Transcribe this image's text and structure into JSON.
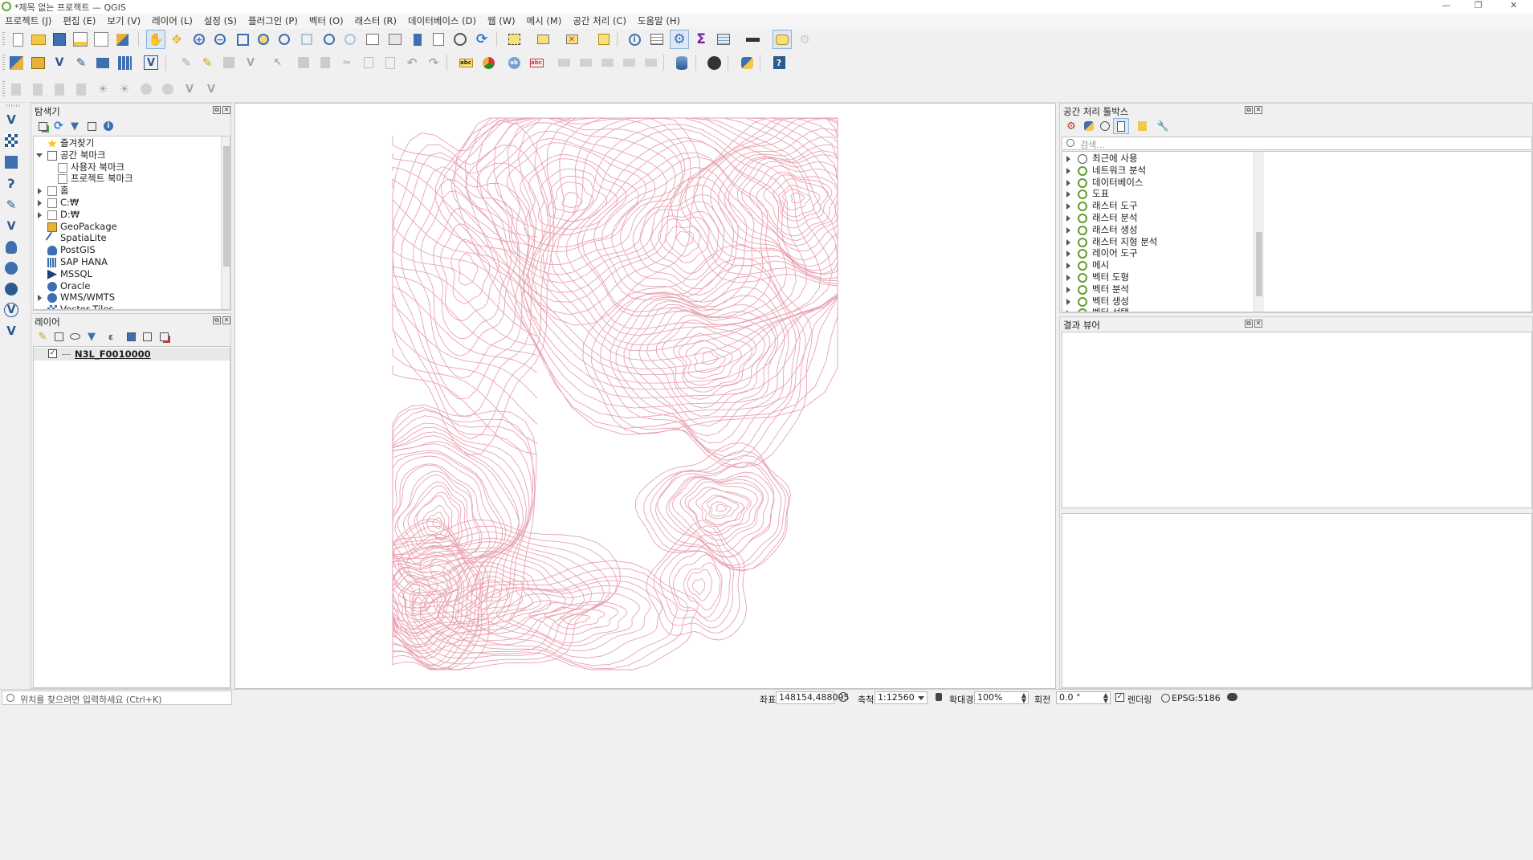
{
  "window": {
    "title": "*제목 없는 프로젝트 — QGIS",
    "controls": [
      "—",
      "❐",
      "✕"
    ]
  },
  "menu": [
    "프로젝트 (J)",
    "편집 (E)",
    "보기 (V)",
    "레이어 (L)",
    "설정 (S)",
    "플러그인 (P)",
    "벡터 (O)",
    "래스터 (R)",
    "데이터베이스 (D)",
    "웹 (W)",
    "메시 (M)",
    "공간 처리 (C)",
    "도움말 (H)"
  ],
  "browser": {
    "title": "탐색기",
    "items": [
      {
        "label": "즐겨찾기",
        "icon": "star-icon",
        "expand": "none"
      },
      {
        "label": "공간 북마크",
        "icon": "bookmark-icon",
        "expand": "down"
      },
      {
        "label": "사용자 북마크",
        "icon": "folder-icon",
        "expand": "none"
      },
      {
        "label": "프로젝트 북마크",
        "icon": "folder-icon",
        "expand": "none"
      },
      {
        "label": "홈",
        "icon": "home-folder-icon",
        "expand": "right"
      },
      {
        "label": "C:₩",
        "icon": "drive-icon",
        "expand": "right"
      },
      {
        "label": "D:₩",
        "icon": "drive-icon",
        "expand": "right"
      },
      {
        "label": "GeoPackage",
        "icon": "geopackage-icon",
        "expand": "none"
      },
      {
        "label": "SpatiaLite",
        "icon": "spatialite-icon",
        "expand": "none"
      },
      {
        "label": "PostGIS",
        "icon": "postgis-icon",
        "expand": "none"
      },
      {
        "label": "SAP HANA",
        "icon": "sap-hana-icon",
        "expand": "none"
      },
      {
        "label": "MSSQL",
        "icon": "mssql-icon",
        "expand": "none"
      },
      {
        "label": "Oracle",
        "icon": "oracle-icon",
        "expand": "none"
      },
      {
        "label": "WMS/WMTS",
        "icon": "wms-icon",
        "expand": "right"
      },
      {
        "label": "Vector Tiles",
        "icon": "vector-tiles-icon",
        "expand": "none"
      }
    ]
  },
  "layers": {
    "title": "레이어",
    "items": [
      {
        "label": "N3L_F0010000",
        "checked": true,
        "symbol_color": "#9a9a9a"
      }
    ]
  },
  "toolbox": {
    "title": "공간 처리 툴박스",
    "search_placeholder": "검색...",
    "items": [
      "최근에 사용",
      "네트워크 분석",
      "데이터베이스",
      "도표",
      "래스터 도구",
      "래스터 분석",
      "래스터 생성",
      "래스터 지형 분석",
      "레이어 도구",
      "메시",
      "벡터 도형",
      "벡터 분석",
      "벡터 생성",
      "벡터 선택"
    ]
  },
  "results": {
    "title": "결과 뷰어"
  },
  "map": {
    "line_color": "#e8a2b2",
    "background": "#ffffff"
  },
  "status": {
    "locator_placeholder": "위치를 찾으려면 입력하세요 (Ctrl+K)",
    "coord_label": "좌표",
    "coord_value": "148154,488095",
    "scale_label": "축척",
    "scale_value": "1:12560",
    "magnifier_label": "확대경",
    "magnifier_value": "100%",
    "rotation_label": "회전",
    "rotation_value": "0.0 °",
    "render_label": "렌더링",
    "crs": "EPSG:5186"
  }
}
